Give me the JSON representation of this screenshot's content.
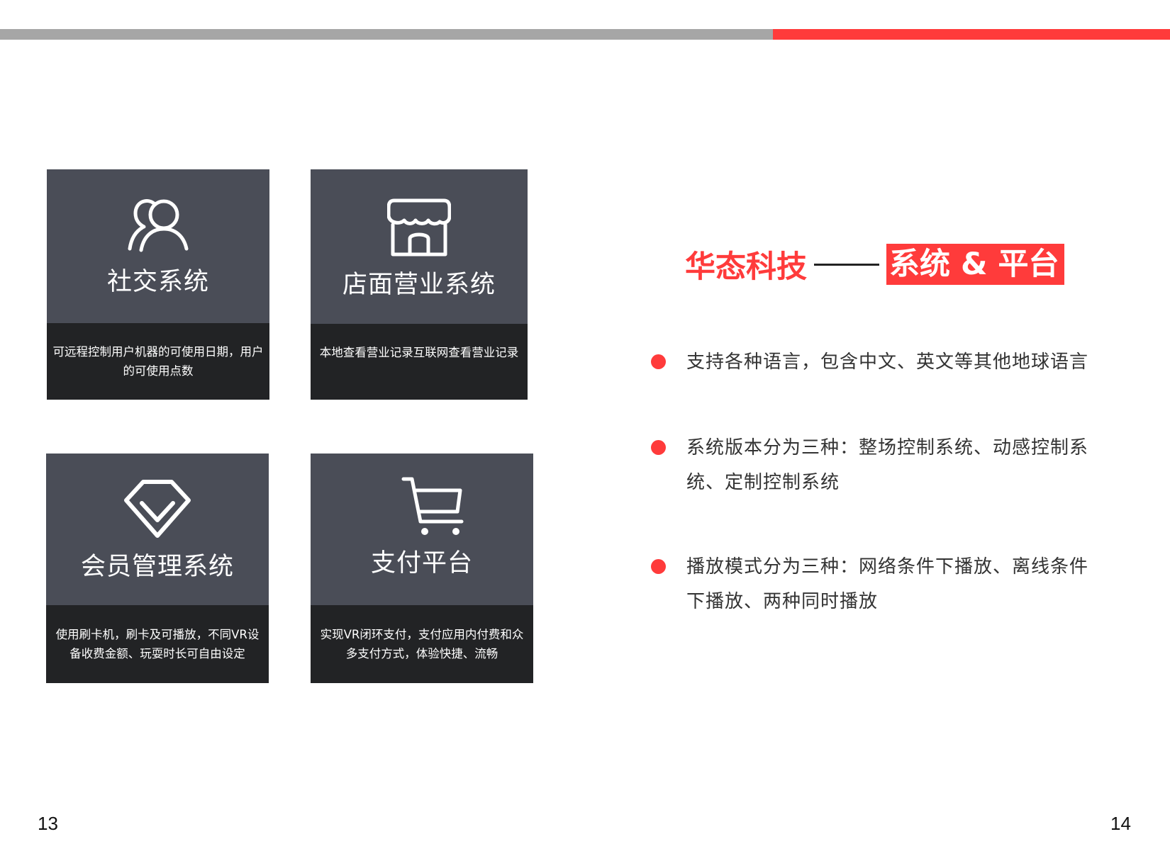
{
  "colors": {
    "accent": "#ff3b3b",
    "card_top": "#4a4d57",
    "card_bottom": "#222325",
    "bar_gray": "#a6a6a6"
  },
  "cards": [
    {
      "title": "社交系统",
      "icon": "users-icon",
      "description": "可远程控制用户机器的可使用日期，用户的可使用点数"
    },
    {
      "title": "店面营业系统",
      "icon": "storefront-icon",
      "description": "本地查看营业记录互联网查看营业记录"
    },
    {
      "title": "会员管理系统",
      "icon": "diamond-v-icon",
      "description": "使用刷卡机，刷卡及可播放，不同VR设备收费金额、玩耍时长可自由设定"
    },
    {
      "title": "支付平台",
      "icon": "shopping-cart-icon",
      "description": "实现VR闭环支付，支付应用内付费和众多支付方式，体验快捷、流畅"
    }
  ],
  "headline": {
    "brand": "华态科技",
    "highlight": "系统 & 平台"
  },
  "bullets": [
    "支持各种语言，包含中文、英文等其他地球语言",
    "系统版本分为三种：整场控制系统、动感控制系统、定制控制系统",
    "播放模式分为三种：网络条件下播放、离线条件下播放、两种同时播放"
  ],
  "page_numbers": {
    "left": "13",
    "right": "14"
  }
}
